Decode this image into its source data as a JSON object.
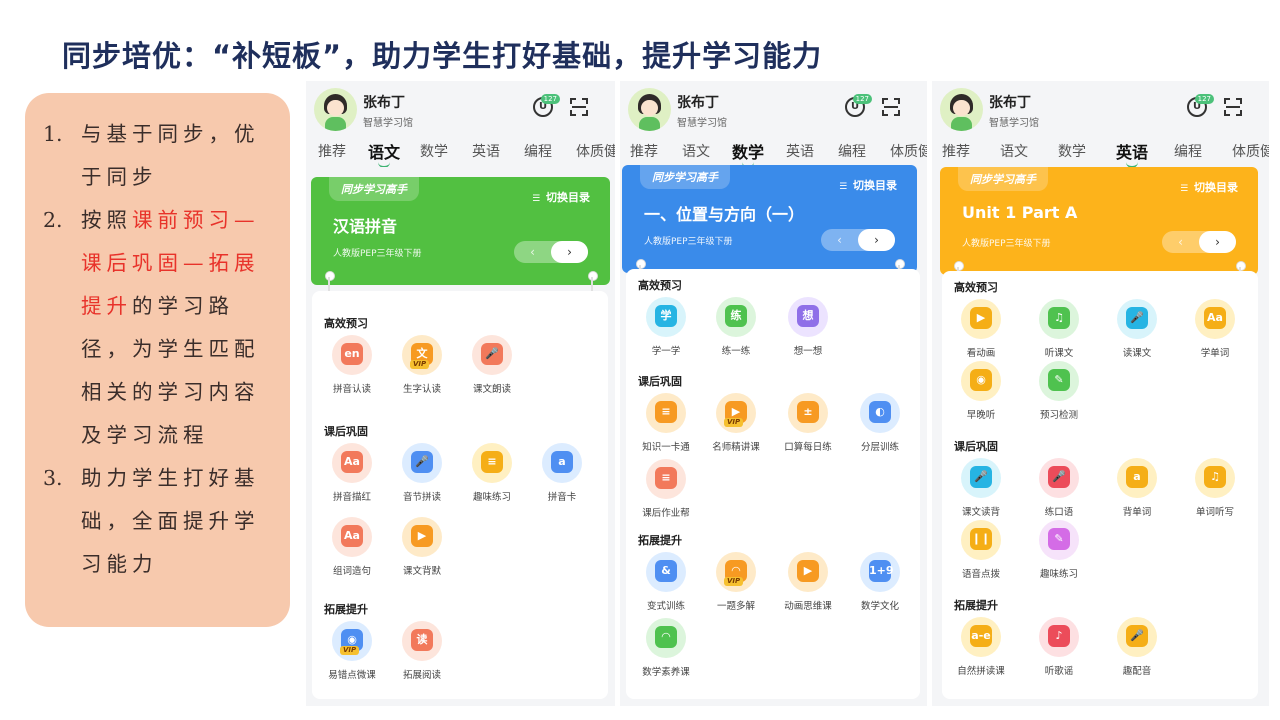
{
  "slide": {
    "title": "同步培优：“补短板”，助力学生打好基础，提升学习能力"
  },
  "bullets": [
    {
      "num": "1.",
      "segments": [
        {
          "text": "与基于同步，优于同步",
          "red": false
        }
      ]
    },
    {
      "num": "2.",
      "segments": [
        {
          "text": "按照",
          "red": false
        },
        {
          "text": "课前预习—课后巩固—拓展提升",
          "red": true
        },
        {
          "text": "的学习路径，为学生匹配相关的学习内容及学习流程",
          "red": false
        }
      ]
    },
    {
      "num": "3.",
      "segments": [
        {
          "text": "助力学生打好基础，全面提升学习能力",
          "red": false
        }
      ]
    }
  ],
  "phones": [
    {
      "user": {
        "name": "张布丁",
        "school": "智慧学习馆"
      },
      "badge": "127",
      "u_glyph": "U",
      "tabs": [
        "推荐",
        "语文",
        "数学",
        "英语",
        "编程",
        "体质健"
      ],
      "active_tab": 1,
      "banner": {
        "tag": "同步学习高手",
        "toggle": "切换目录",
        "title": "汉语拼音",
        "subtitle": "人教版PEP三年级下册",
        "prev": "‹",
        "next": "›",
        "color": "#52c041"
      },
      "sections": [
        {
          "title": "高效预习",
          "items": [
            {
              "label": "拼音认读",
              "glyph": "en",
              "color": "pink",
              "vip": false
            },
            {
              "label": "生字认读",
              "glyph": "文",
              "color": "orange",
              "vip": true
            },
            {
              "label": "课文朗读",
              "glyph": "🎤",
              "color": "pink",
              "vip": false
            }
          ]
        },
        {
          "title": "课后巩固",
          "items": [
            {
              "label": "拼音描红",
              "glyph": "Aa",
              "color": "pink",
              "vip": false
            },
            {
              "label": "音节拼读",
              "glyph": "🎤",
              "color": "blue",
              "vip": false
            },
            {
              "label": "趣味练习",
              "glyph": "≡",
              "color": "yellow",
              "vip": false
            },
            {
              "label": "拼音卡",
              "glyph": "a",
              "color": "blue",
              "vip": false
            },
            {
              "label": "组词造句",
              "glyph": "Aa",
              "color": "pink",
              "vip": false
            },
            {
              "label": "课文背默",
              "glyph": "▶",
              "color": "orange",
              "vip": false
            }
          ]
        },
        {
          "title": "拓展提升",
          "items": [
            {
              "label": "易错点微课",
              "glyph": "◉",
              "color": "blue",
              "vip": true
            },
            {
              "label": "拓展阅读",
              "glyph": "读",
              "color": "pink",
              "vip": false
            }
          ]
        }
      ]
    },
    {
      "user": {
        "name": "张布丁",
        "school": "智慧学习馆"
      },
      "badge": "127",
      "u_glyph": "U",
      "tabs": [
        "推荐",
        "语文",
        "数学",
        "英语",
        "编程",
        "体质健"
      ],
      "active_tab": 2,
      "banner": {
        "tag": "同步学习高手",
        "toggle": "切换目录",
        "title": "一、位置与方向（一）",
        "subtitle": "人教版PEP三年级下册",
        "prev": "‹",
        "next": "›",
        "color": "#3a8bea"
      },
      "sections": [
        {
          "title": "高效预习",
          "items": [
            {
              "label": "学一学",
              "glyph": "学",
              "color": "cyan",
              "vip": false
            },
            {
              "label": "练一练",
              "glyph": "练",
              "color": "green",
              "vip": false
            },
            {
              "label": "想一想",
              "glyph": "想",
              "color": "purple",
              "vip": false
            }
          ]
        },
        {
          "title": "课后巩固",
          "items": [
            {
              "label": "知识一卡通",
              "glyph": "≡",
              "color": "orange",
              "vip": false
            },
            {
              "label": "名师精讲课",
              "glyph": "▶",
              "color": "orange",
              "vip": true
            },
            {
              "label": "口算每日练",
              "glyph": "±",
              "color": "orange",
              "vip": false
            },
            {
              "label": "分层训练",
              "glyph": "◐",
              "color": "blue",
              "vip": false
            },
            {
              "label": "课后作业帮",
              "glyph": "≡",
              "color": "pink",
              "vip": false
            }
          ]
        },
        {
          "title": "拓展提升",
          "items": [
            {
              "label": "变式训练",
              "glyph": "&",
              "color": "blue",
              "vip": false
            },
            {
              "label": "一题多解",
              "glyph": "◠",
              "color": "orange",
              "vip": true
            },
            {
              "label": "动画思维课",
              "glyph": "▶",
              "color": "orange",
              "vip": false
            },
            {
              "label": "数学文化",
              "glyph": "1+9",
              "color": "blue",
              "vip": false
            },
            {
              "label": "数学素养课",
              "glyph": "◠",
              "color": "green",
              "vip": false
            }
          ]
        }
      ]
    },
    {
      "user": {
        "name": "张布丁",
        "school": "智慧学习馆"
      },
      "badge": "127",
      "u_glyph": "U",
      "tabs": [
        "推荐",
        "语文",
        "数学",
        "英语",
        "编程",
        "体质健"
      ],
      "active_tab": 3,
      "banner": {
        "tag": "同步学习高手",
        "toggle": "切换目录",
        "title": "Unit 1 Part A",
        "subtitle": "人教版PEP三年级下册",
        "prev": "‹",
        "next": "›",
        "color": "#fdb31b"
      },
      "sections": [
        {
          "title": "高效预习",
          "items": [
            {
              "label": "看动画",
              "glyph": "▶",
              "color": "yellow",
              "vip": false
            },
            {
              "label": "听课文",
              "glyph": "♫",
              "color": "green",
              "vip": false
            },
            {
              "label": "读课文",
              "glyph": "🎤",
              "color": "cyan",
              "vip": false
            },
            {
              "label": "学单词",
              "glyph": "Aa",
              "color": "yellow",
              "vip": false
            },
            {
              "label": "早晚听",
              "glyph": "◉",
              "color": "yellow",
              "vip": false
            },
            {
              "label": "预习检测",
              "glyph": "✎",
              "color": "green",
              "vip": false
            }
          ]
        },
        {
          "title": "课后巩固",
          "items": [
            {
              "label": "课文读背",
              "glyph": "🎤",
              "color": "cyan",
              "vip": false
            },
            {
              "label": "练口语",
              "glyph": "🎤",
              "color": "red",
              "vip": false
            },
            {
              "label": "背单词",
              "glyph": "a",
              "color": "yellow",
              "vip": false
            },
            {
              "label": "单词听写",
              "glyph": "♫",
              "color": "yellow",
              "vip": false
            },
            {
              "label": "语音点拨",
              "glyph": "❙❙",
              "color": "yellow",
              "vip": false
            },
            {
              "label": "趣味练习",
              "glyph": "✎",
              "color": "lilac",
              "vip": false
            }
          ]
        },
        {
          "title": "拓展提升",
          "items": [
            {
              "label": "自然拼读课",
              "glyph": "a-e",
              "color": "yellow",
              "vip": false
            },
            {
              "label": "听歌谣",
              "glyph": "♪",
              "color": "red",
              "vip": false
            },
            {
              "label": "趣配音",
              "glyph": "🎤",
              "color": "yellow",
              "vip": false
            }
          ]
        }
      ]
    }
  ]
}
